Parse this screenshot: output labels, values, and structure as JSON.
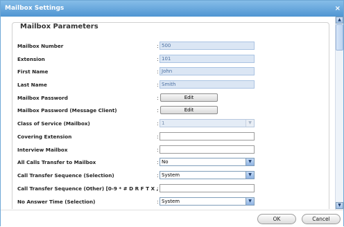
{
  "dialog": {
    "title": "Mailbox Settings",
    "close_glyph": "×"
  },
  "section": {
    "title": "Mailbox Parameters"
  },
  "fields": {
    "mailbox_number": {
      "label": "Mailbox Number",
      "value": "500"
    },
    "extension": {
      "label": "Extension",
      "value": "101"
    },
    "first_name": {
      "label": "First Name",
      "value": "John"
    },
    "last_name": {
      "label": "Last Name",
      "value": "Smith"
    },
    "mailbox_password": {
      "label": "Mailbox Password",
      "button": "Edit"
    },
    "mailbox_password_mc": {
      "label": "Mailbox Password (Message Client)",
      "button": "Edit"
    },
    "class_of_service": {
      "label": "Class of Service (Mailbox)",
      "value": "1"
    },
    "covering_extension": {
      "label": "Covering Extension",
      "value": ""
    },
    "interview_mailbox": {
      "label": "Interview Mailbox",
      "value": ""
    },
    "all_calls_transfer": {
      "label": "All Calls Transfer to Mailbox",
      "value": "No"
    },
    "cts_selection": {
      "label": "Call Transfer Sequence (Selection)",
      "value": "System"
    },
    "cts_other": {
      "label": "Call Transfer Sequence (Other) [0-9 * # D R F T X , ;]",
      "value": ""
    },
    "no_answer_time": {
      "label": "No Answer Time (Selection)",
      "value": "System"
    }
  },
  "colon": ":",
  "footer": {
    "ok_label": "OK",
    "cancel_label": "Cancel"
  },
  "icons": {
    "close": "close-icon",
    "dropdown": "chevron-down-icon",
    "scroll_up": "scroll-up-icon",
    "scroll_down": "scroll-down-icon"
  },
  "colors": {
    "titlebar": "#5a9fd8",
    "readonly_field": "#dbe6f4"
  }
}
